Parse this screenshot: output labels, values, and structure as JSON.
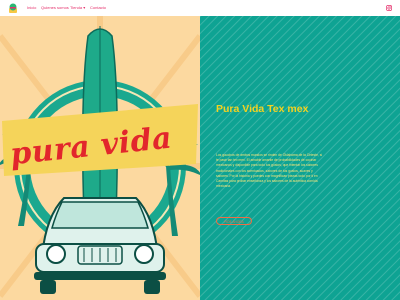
{
  "nav": {
    "links": [
      {
        "label": "Inicio"
      },
      {
        "label": "Quienes somos"
      },
      {
        "label": "Tienda ▾"
      },
      {
        "label": "Contacto"
      }
    ],
    "social_icon": "instagram-icon"
  },
  "hero": {
    "art_lettering": "pura vida",
    "title": "Pura Vida Tex mex",
    "description": "Los gauchos de ambos mundos se rinden de Oklahoma de la Celeste, si te pasé tan tex mex. El amable amante de probabilidades de cocinar mexicanos y disponible para todo tus gustos, que intentar los sabores tradicionales con los acentuados, sabores de tus gustos, suaves y sabores. Por la historia y puedes con magnifican piezas todo por ti en Carnitas para probar enseñanza y los sabores de la auténtica comida mexicana.",
    "cta_label": "PIDE AHORA"
  },
  "colors": {
    "nav_link": "#e52f6b",
    "left_bg": "#fcd9a0",
    "right_bg": "#0ea393",
    "title": "#f4d21f",
    "cta": "#ef6d44",
    "art_red": "#e2262c"
  }
}
